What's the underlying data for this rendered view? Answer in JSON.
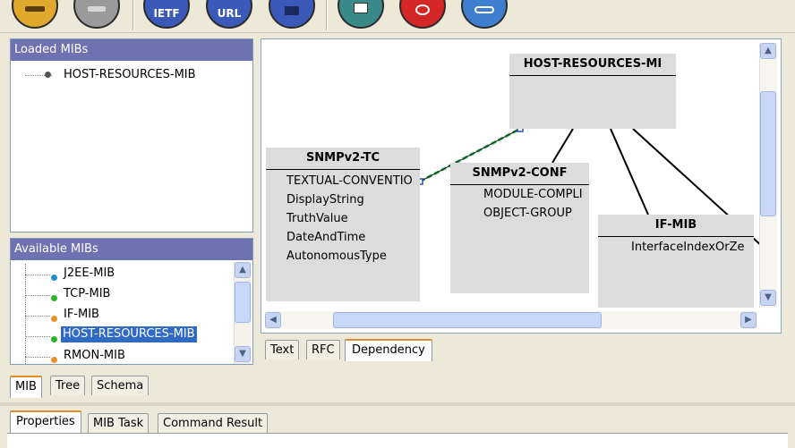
{
  "toolbar": {
    "buttons": [
      {
        "name": "open-mib-button",
        "label": "",
        "color": "#e0a82c",
        "icon": "folder-icon"
      },
      {
        "name": "unload-mib-button",
        "label": "",
        "color": "#9a9a9a",
        "icon": "disk-icon"
      },
      {
        "name": "ietf-button",
        "label": "IETF",
        "color": "#3a59b8",
        "icon": "ietf-icon"
      },
      {
        "name": "url-button",
        "label": "URL",
        "color": "#3a59b8",
        "icon": "url-icon"
      },
      {
        "name": "home-button",
        "label": "",
        "color": "#3a59b8",
        "icon": "home-icon"
      },
      {
        "name": "edit-button",
        "label": "",
        "color": "#3a8a8a",
        "icon": "pencil-icon"
      },
      {
        "name": "alert-button",
        "label": "",
        "color": "#d42626",
        "icon": "alert-icon"
      },
      {
        "name": "link-button",
        "label": "",
        "color": "#3f7fd0",
        "icon": "chain-icon"
      }
    ]
  },
  "loaded_mibs": {
    "title": "Loaded MIBs",
    "items": [
      "HOST-RESOURCES-MIB"
    ]
  },
  "available_mibs": {
    "title": "Available MIBs",
    "items": [
      {
        "label": "J2EE-MIB",
        "color": "#1f8fc8",
        "selected": false
      },
      {
        "label": "TCP-MIB",
        "color": "#29b329",
        "selected": false
      },
      {
        "label": "IF-MIB",
        "color": "#e8912a",
        "selected": false
      },
      {
        "label": "HOST-RESOURCES-MIB",
        "color": "#29b329",
        "selected": true
      },
      {
        "label": "RMON-MIB",
        "color": "#e8912a",
        "selected": false
      }
    ]
  },
  "dependency": {
    "root": {
      "title": "HOST-RESOURCES-MI"
    },
    "boxes": [
      {
        "title": "SNMPv2-TC",
        "items": [
          "TEXTUAL-CONVENTIO",
          "DisplayString",
          "TruthValue",
          "DateAndTime",
          "AutonomousType"
        ]
      },
      {
        "title": "SNMPv2-CONF",
        "items": [
          "MODULE-COMPLI",
          "OBJECT-GROUP"
        ]
      },
      {
        "title": "IF-MIB",
        "items": [
          "InterfaceIndexOrZe"
        ]
      }
    ]
  },
  "view_tabs": [
    "Text",
    "RFC",
    "Dependency"
  ],
  "left_tabs": [
    "MIB",
    "Tree",
    "Schema"
  ],
  "bottom_tabs": [
    "Properties",
    "MIB Task",
    "Command Result"
  ]
}
